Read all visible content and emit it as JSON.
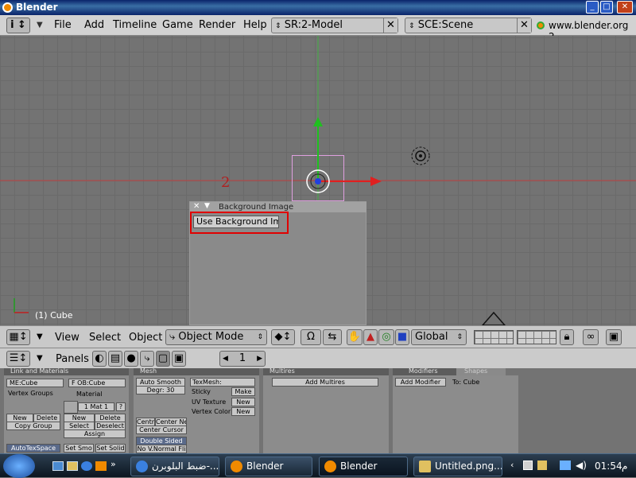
{
  "window": {
    "title": "Blender"
  },
  "menu": {
    "items": [
      "File",
      "Add",
      "Timeline",
      "Game",
      "Render",
      "Help"
    ],
    "screen": "SR:2-Model",
    "scene": "SCE:Scene",
    "url": "www.blender.org 2"
  },
  "viewport": {
    "object_label": "(1) Cube",
    "layer_number": "2",
    "panel": {
      "title": "Background Image",
      "use_bg_button": "Use Background Imag"
    }
  },
  "view_header": {
    "view": "View",
    "select": "Select",
    "object": "Object",
    "mode": "Object Mode",
    "orientation": "Global"
  },
  "buttons_header": {
    "panels_label": "Panels",
    "frame": "1"
  },
  "panels": {
    "link_materials": {
      "title": "Link and Materials",
      "me": "ME:Cube",
      "ob": "F OB:Cube",
      "vertex_groups": "Vertex Groups",
      "material": "Material",
      "mat": "1 Mat 1",
      "q": "?",
      "new": "New",
      "delete": "Delete",
      "copy_group": "Copy Group",
      "new2": "New",
      "delete2": "Delete",
      "select": "Select",
      "deselect": "Deselect",
      "assign": "Assign",
      "autotex": "AutoTexSpace",
      "set_smo": "Set Smo",
      "set_solid": "Set Solid"
    },
    "mesh": {
      "title": "Mesh",
      "auto_smooth": "Auto Smooth",
      "degr": "Degr: 30",
      "centre": "Centre",
      "center_new": "Center Ne",
      "center_cursor": "Center Cursor",
      "double_sided": "Double Sided",
      "no_vnormal": "No V.Normal Fli",
      "texmesh": "TexMesh:",
      "sticky": "Sticky",
      "make": "Make",
      "uv_texture": "UV Texture",
      "new_uv": "New",
      "vertex_color": "Vertex Color",
      "new_vc": "New"
    },
    "multires": {
      "title": "Multires",
      "add": "Add Multires"
    },
    "modifiers": {
      "title": "Modifiers",
      "shapes": "Shapes",
      "add": "Add Modifier",
      "to": "To: Cube"
    }
  },
  "taskbar": {
    "tasks": [
      "ضبط البلوبرن-...",
      "Blender",
      "Blender",
      "Untitled.png..."
    ],
    "time": "01:54",
    "ampm": "م"
  }
}
